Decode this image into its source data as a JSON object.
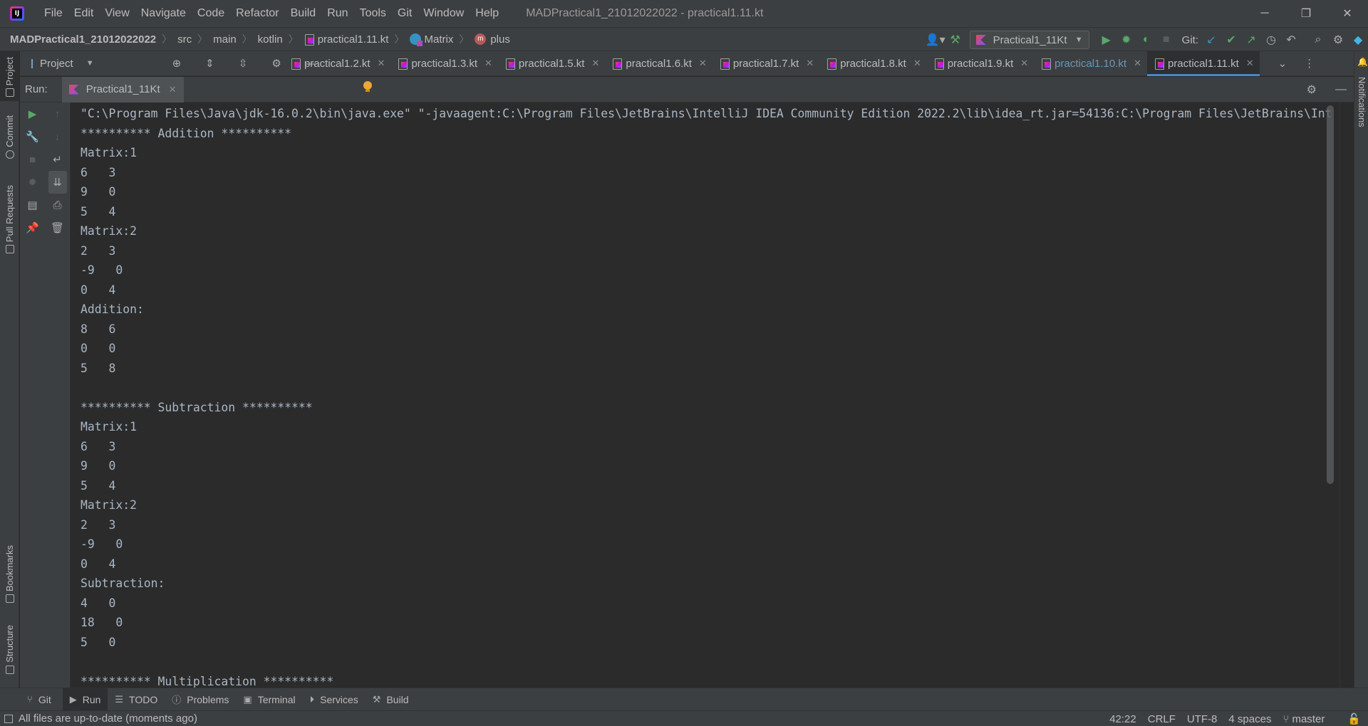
{
  "window": {
    "title": "MADPractical1_21012022022 - practical1.11.kt",
    "menu": [
      "File",
      "Edit",
      "View",
      "Navigate",
      "Code",
      "Refactor",
      "Build",
      "Run",
      "Tools",
      "Git",
      "Window",
      "Help"
    ],
    "controls": {
      "minimize": "─",
      "restore": "❐",
      "close": "✕"
    }
  },
  "breadcrumbs": {
    "project": "MADPractical1_21012022022",
    "items": [
      "src",
      "main",
      "kotlin",
      "practical1.11.kt",
      "Matrix",
      "plus"
    ]
  },
  "toolbar": {
    "run_config": "Practical1_11Kt",
    "git_label": "Git:"
  },
  "project_panel": {
    "label": "Project"
  },
  "tabs": [
    {
      "label": "practical1.2.kt",
      "active": false
    },
    {
      "label": "practical1.3.kt",
      "active": false
    },
    {
      "label": "practical1.5.kt",
      "active": false
    },
    {
      "label": "practical1.6.kt",
      "active": false
    },
    {
      "label": "practical1.7.kt",
      "active": false
    },
    {
      "label": "practical1.8.kt",
      "active": false
    },
    {
      "label": "practical1.9.kt",
      "active": false
    },
    {
      "label": "practical1.10.kt",
      "active": false,
      "modified": true
    },
    {
      "label": "practical1.11.kt",
      "active": true
    }
  ],
  "left_stripe": [
    "Project",
    "Commit",
    "Pull Requests",
    "Bookmarks",
    "Structure"
  ],
  "right_stripe": [
    "Notifications"
  ],
  "run_panel": {
    "label": "Run:",
    "tab": "Practical1_11Kt"
  },
  "console": {
    "lines": [
      "\"C:\\Program Files\\Java\\jdk-16.0.2\\bin\\java.exe\" \"-javaagent:C:\\Program Files\\JetBrains\\IntelliJ IDEA Community Edition 2022.2\\lib\\idea_rt.jar=54136:C:\\Program Files\\JetBrains\\Int",
      "********** Addition **********",
      "Matrix:1",
      "6   3",
      "9   0",
      "5   4",
      "Matrix:2",
      "2   3",
      "-9   0",
      "0   4",
      "Addition:",
      "8   6",
      "0   0",
      "5   8",
      "",
      "********** Subtraction **********",
      "Matrix:1",
      "6   3",
      "9   0",
      "5   4",
      "Matrix:2",
      "2   3",
      "-9   0",
      "0   4",
      "Subtraction:",
      "4   0",
      "18   0",
      "5   0",
      "",
      "********** Multiplication **********"
    ]
  },
  "bottom_tools": [
    {
      "label": "Git",
      "icon": "git-branch-icon",
      "active": false
    },
    {
      "label": "Run",
      "icon": "play-icon",
      "active": true
    },
    {
      "label": "TODO",
      "icon": "list-icon",
      "active": false
    },
    {
      "label": "Problems",
      "icon": "info-icon",
      "active": false
    },
    {
      "label": "Terminal",
      "icon": "terminal-icon",
      "active": false
    },
    {
      "label": "Services",
      "icon": "services-icon",
      "active": false
    },
    {
      "label": "Build",
      "icon": "hammer-icon",
      "active": false
    }
  ],
  "status": {
    "message": "All files are up-to-date (moments ago)",
    "position": "42:22",
    "line_separator": "CRLF",
    "encoding": "UTF-8",
    "indent": "4 spaces",
    "branch": "master"
  },
  "colors": {
    "background": "#2b2b2b",
    "chrome": "#3c3f41",
    "console_text": "#a9b7c6",
    "accent": "#4a88c7",
    "run_green": "#59a869"
  }
}
